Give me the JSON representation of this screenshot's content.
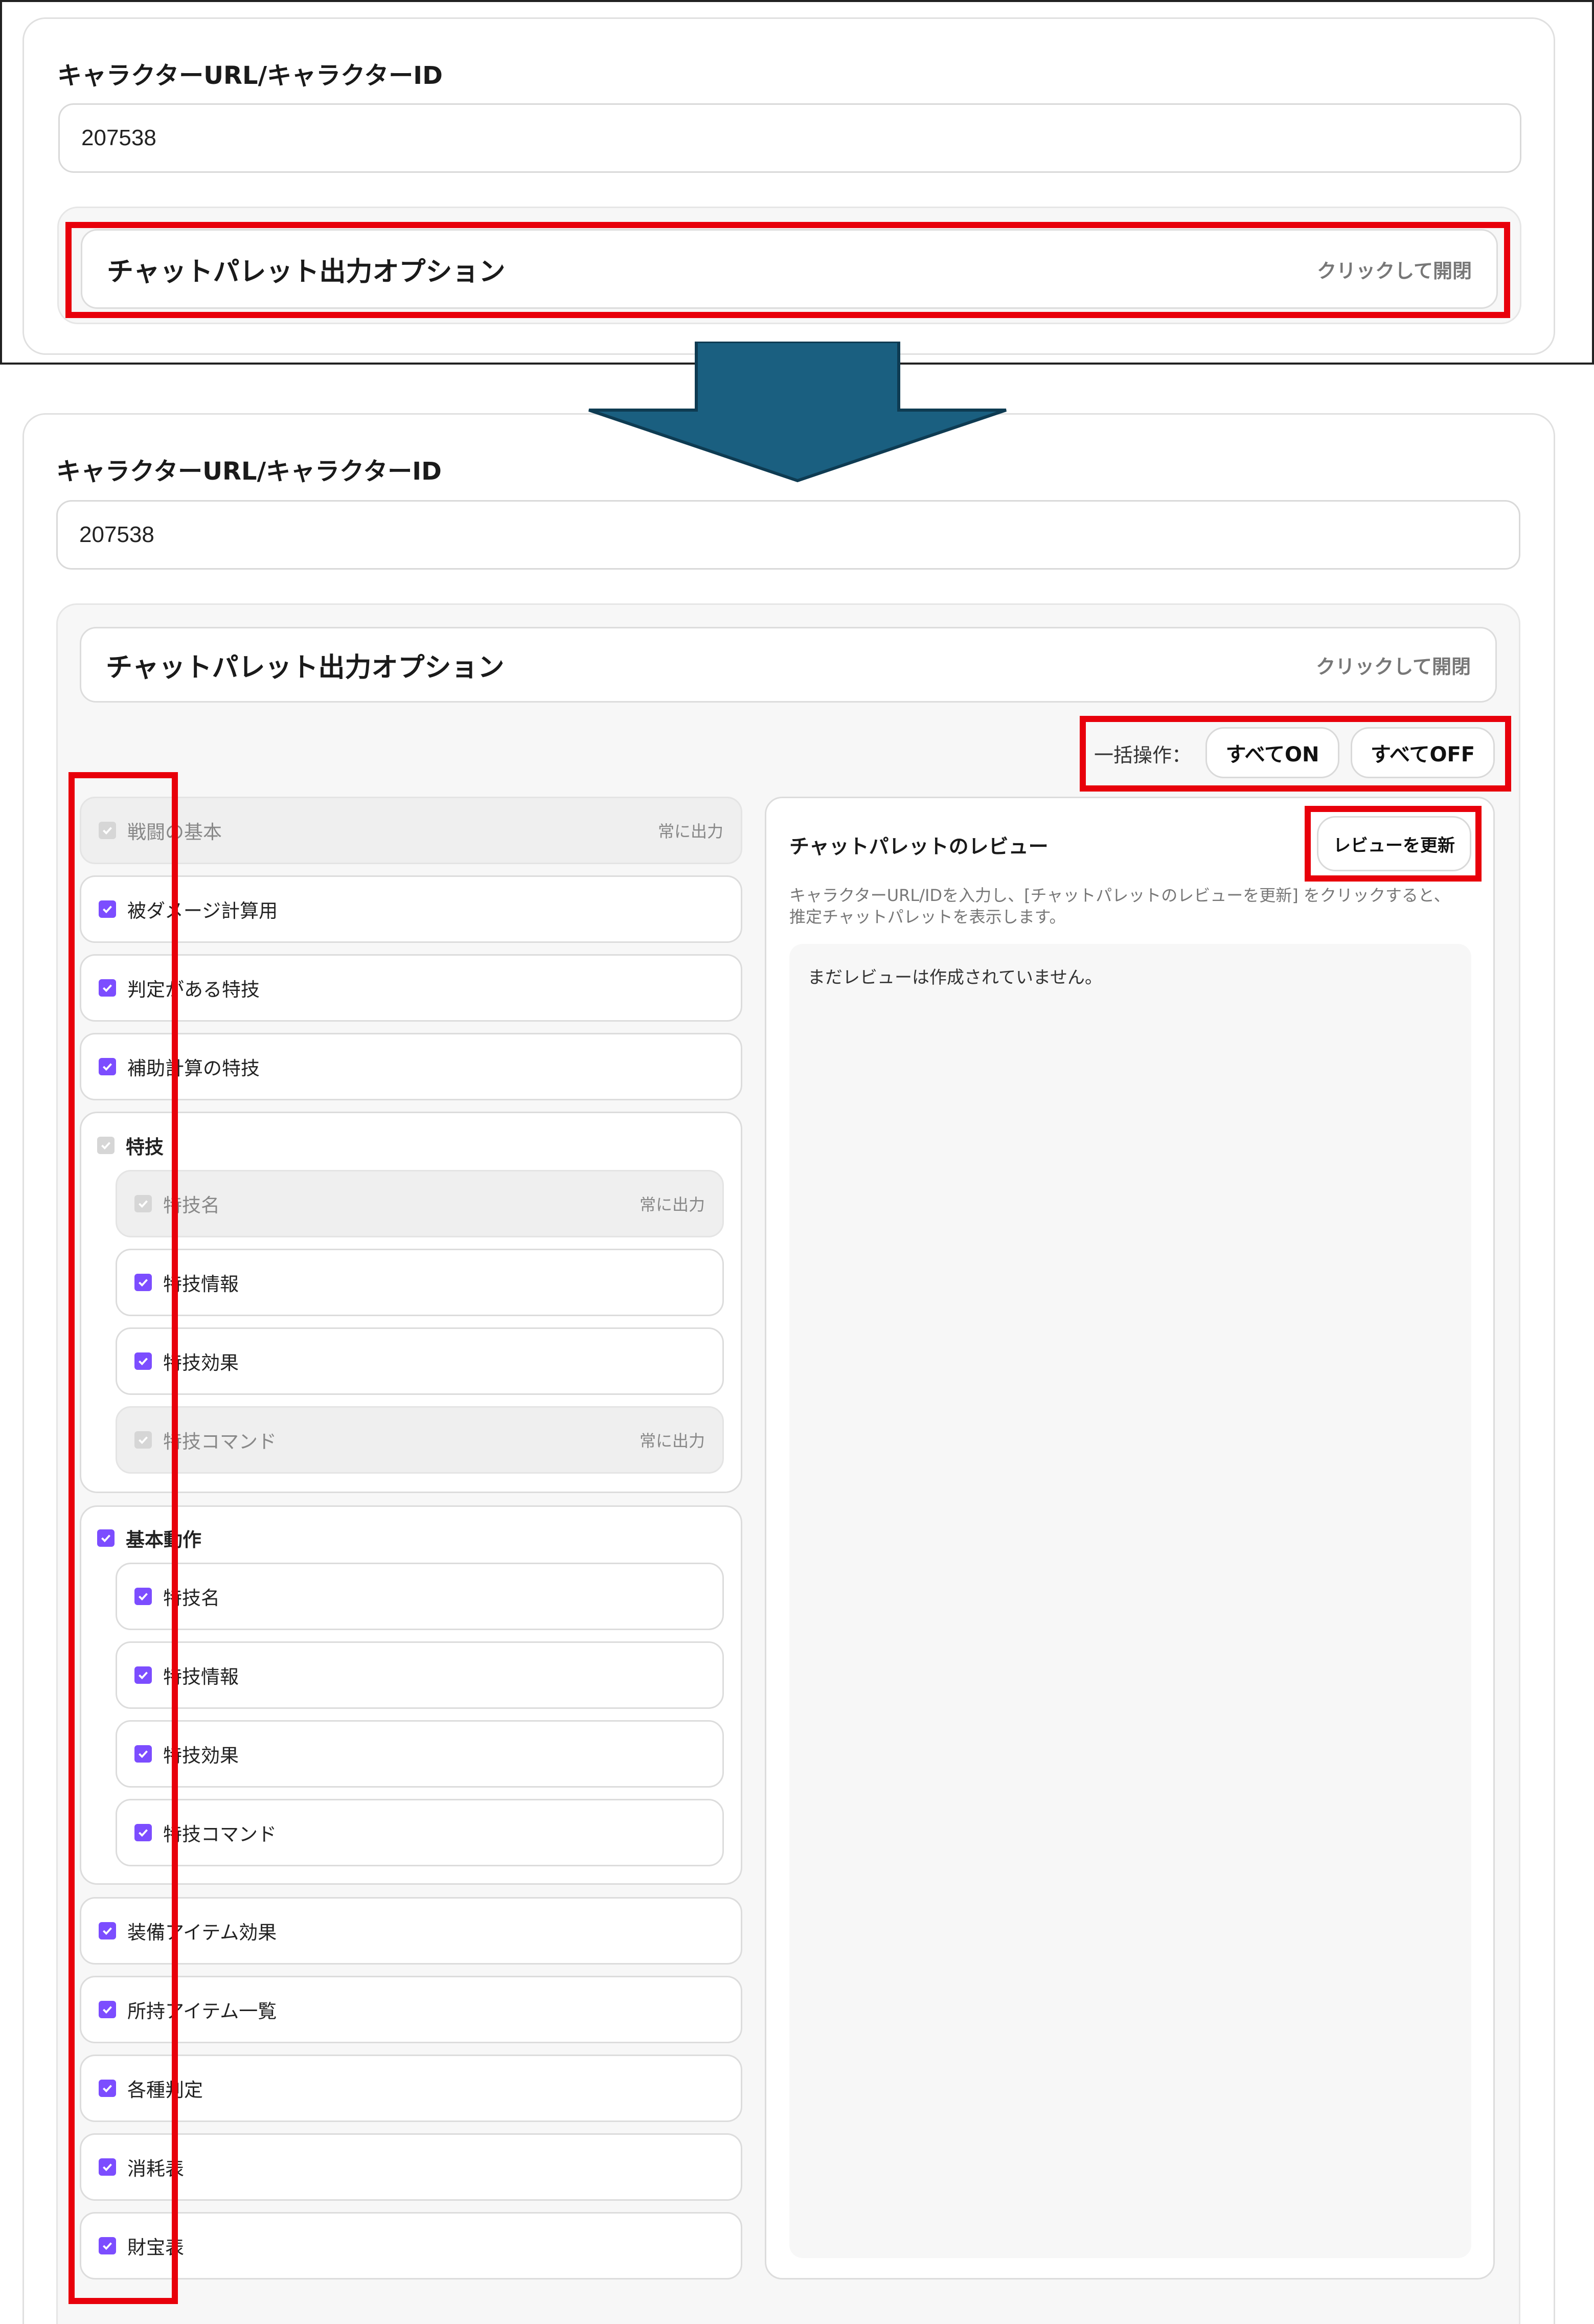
{
  "top": {
    "field_label": "キャラクターURL/キャラクターID",
    "field_value": "207538",
    "options_title": "チャットパレット出力オプション",
    "options_hint": "クリックして開閉"
  },
  "bottom": {
    "field_label": "キャラクターURL/キャラクターID",
    "field_value": "207538",
    "options_title": "チャットパレット出力オプション",
    "options_hint": "クリックして開閉",
    "bulk_label": "一括操作：",
    "all_on": "すべてON",
    "all_off": "すべてOFF",
    "always_output": "常に出力",
    "options": [
      {
        "label": "戦闘の基本",
        "checked": true,
        "fixed": true
      },
      {
        "label": "被ダメージ計算用",
        "checked": true
      },
      {
        "label": "判定がある特技",
        "checked": true
      },
      {
        "label": "補助計算の特技",
        "checked": true
      }
    ],
    "group_skill": {
      "title": "特技",
      "items": [
        {
          "label": "特技名",
          "fixed": true
        },
        {
          "label": "特技情報"
        },
        {
          "label": "特技効果"
        },
        {
          "label": "特技コマンド",
          "fixed": true
        }
      ]
    },
    "group_basic": {
      "title": "基本動作",
      "items": [
        {
          "label": "特技名"
        },
        {
          "label": "特技情報"
        },
        {
          "label": "特技効果"
        },
        {
          "label": "特技コマンド"
        }
      ]
    },
    "options_after": [
      {
        "label": "装備アイテム効果"
      },
      {
        "label": "所持アイテム一覧"
      },
      {
        "label": "各種判定"
      },
      {
        "label": "消耗表"
      },
      {
        "label": "財宝表"
      }
    ],
    "review": {
      "title": "チャットパレットのレビュー",
      "refresh_button": "レビューを更新",
      "description_line1": "キャラクターURL/IDを入力し、[チャットパレットのレビューを更新] をクリックすると、",
      "description_line2": "推定チャットパレットを表示します。",
      "empty_message": "まだレビューは作成されていません。"
    }
  },
  "colors": {
    "accent": "#7c4dff",
    "highlight": "#e8000b",
    "arrow": "#1a5f80"
  }
}
